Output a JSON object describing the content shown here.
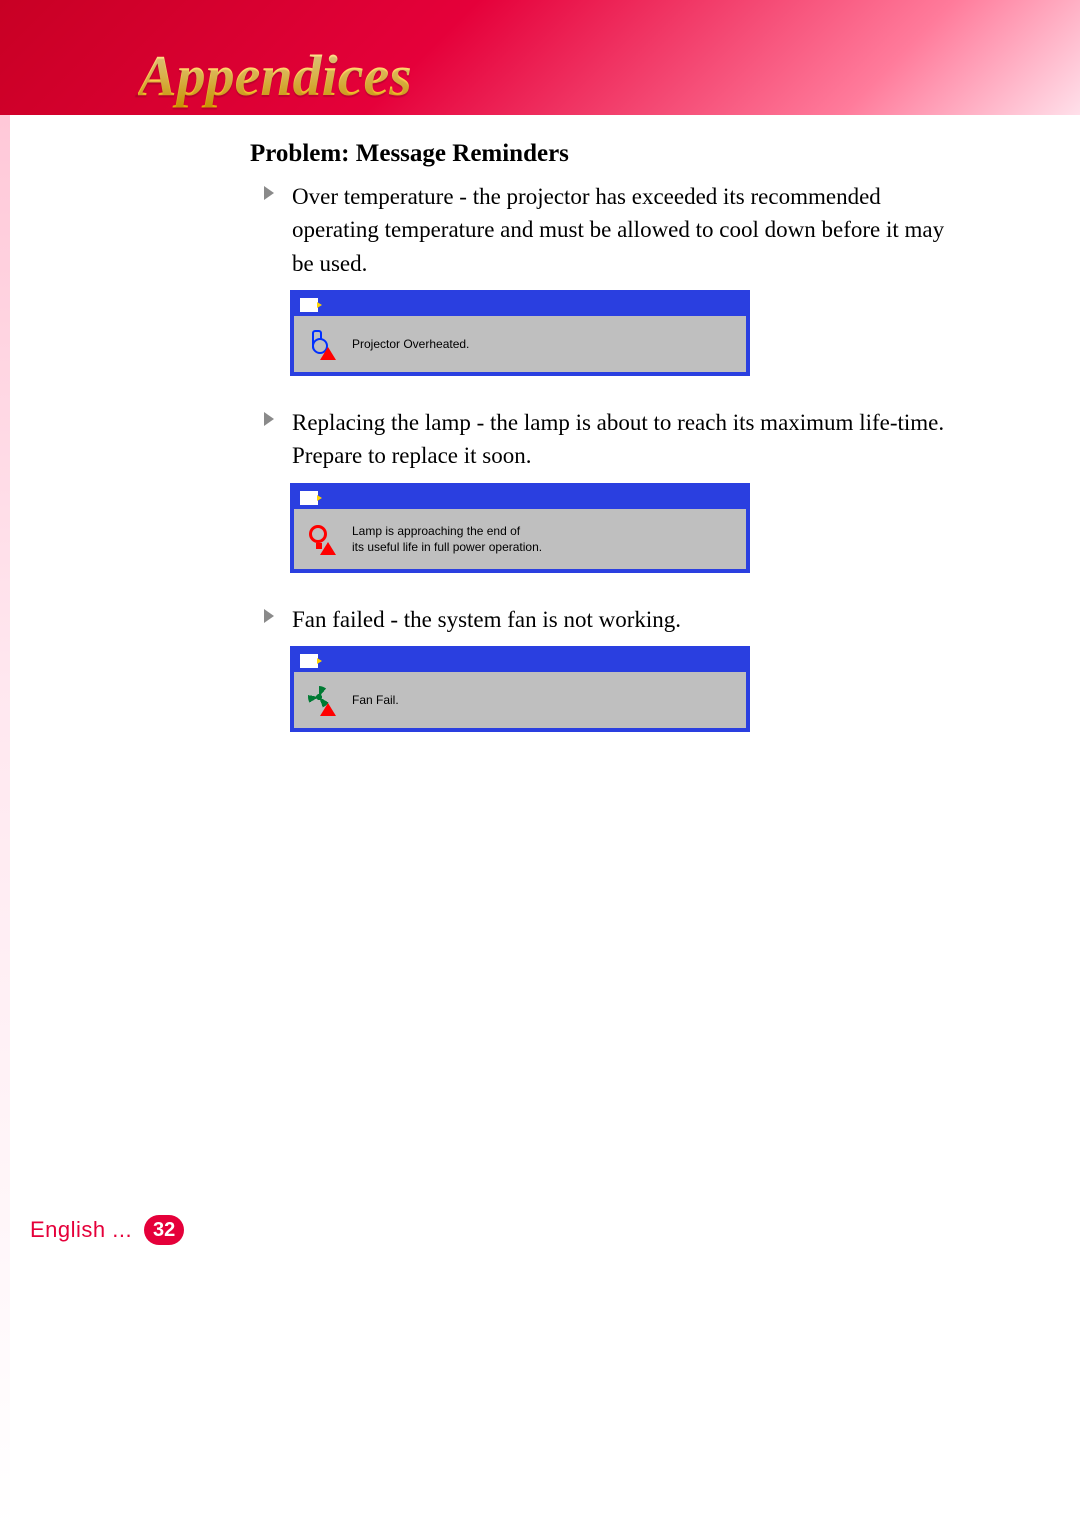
{
  "header": {
    "title": "Appendices"
  },
  "section": {
    "heading": "Problem: Message Reminders",
    "items": [
      {
        "text": "Over temperature - the projector has exceeded its recommended operating temperature and must be allowed to cool down before it may be used.",
        "dialog_text": "Projector Overheated.",
        "icon": "thermometer-warning-icon"
      },
      {
        "text": "Replacing the lamp - the lamp is about to reach its maximum life-time. Prepare to replace  it soon.",
        "dialog_text": "Lamp is approaching the end of\nits useful life in full power operation.",
        "icon": "lamp-warning-icon"
      },
      {
        "text": "Fan failed - the system fan is not working.",
        "dialog_text": "Fan Fail.",
        "icon": "fan-warning-icon"
      }
    ]
  },
  "footer": {
    "language": "English ...",
    "page": "32"
  }
}
